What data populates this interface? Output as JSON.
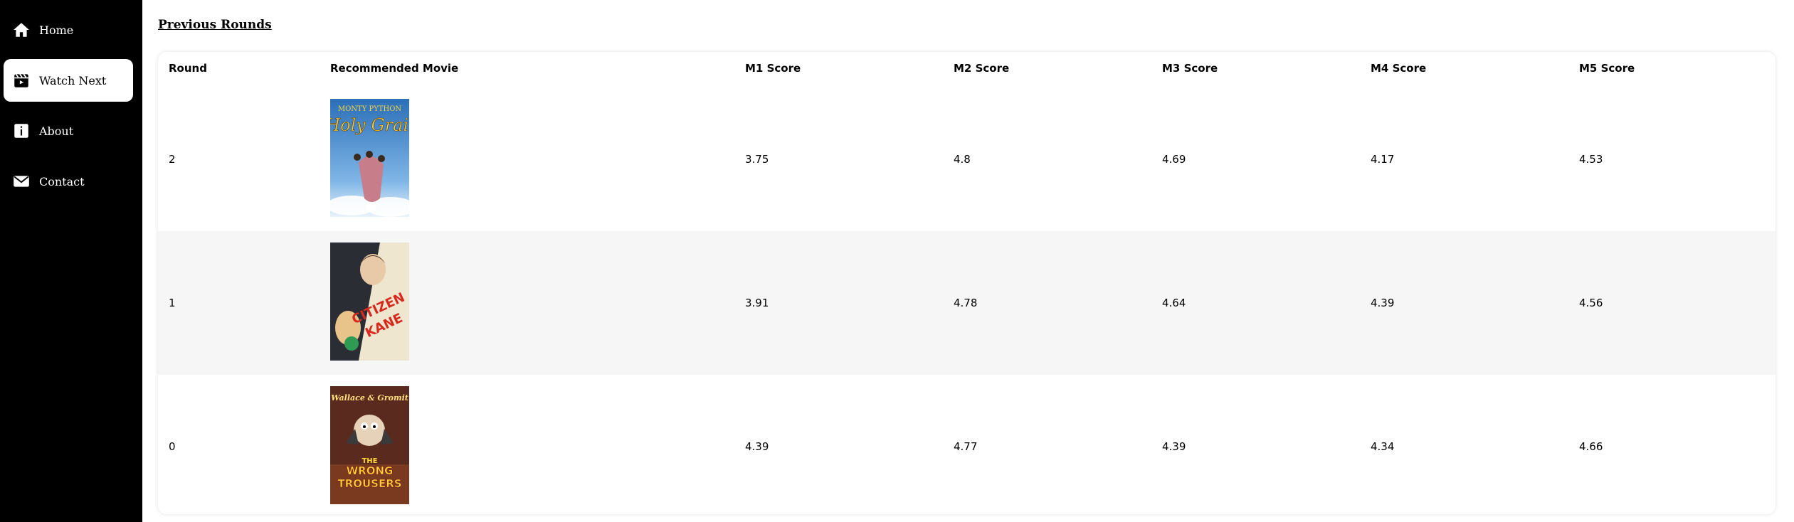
{
  "sidebar": {
    "items": [
      {
        "label": "Home",
        "icon": "home-icon",
        "active": false
      },
      {
        "label": "Watch Next",
        "icon": "clapperboard-icon",
        "active": true
      },
      {
        "label": "About",
        "icon": "info-icon",
        "active": false
      },
      {
        "label": "Contact",
        "icon": "mail-icon",
        "active": false
      }
    ]
  },
  "main": {
    "section_title": "Previous Rounds",
    "table": {
      "headers": [
        "Round",
        "Recommended Movie",
        "M1 Score",
        "M2 Score",
        "M3 Score",
        "M4 Score",
        "M5 Score"
      ],
      "rows": [
        {
          "round": "2",
          "poster": "Monty Python Holy Grail poster",
          "poster_text": [
            "MONTY PYTHON",
            "Holy Grail"
          ],
          "m1": "3.75",
          "m2": "4.8",
          "m3": "4.69",
          "m4": "4.17",
          "m5": "4.53"
        },
        {
          "round": "1",
          "poster": "Citizen Kane poster",
          "poster_text": [
            "CITIZEN",
            "KANE"
          ],
          "m1": "3.91",
          "m2": "4.78",
          "m3": "4.64",
          "m4": "4.39",
          "m5": "4.56"
        },
        {
          "round": "0",
          "poster": "Wallace & Gromit The Wrong Trousers poster",
          "poster_text": [
            "Wallace & Gromit",
            "THE",
            "WRONG",
            "TROUSERS"
          ],
          "m1": "4.39",
          "m2": "4.77",
          "m3": "4.39",
          "m4": "4.34",
          "m5": "4.66"
        }
      ]
    }
  }
}
